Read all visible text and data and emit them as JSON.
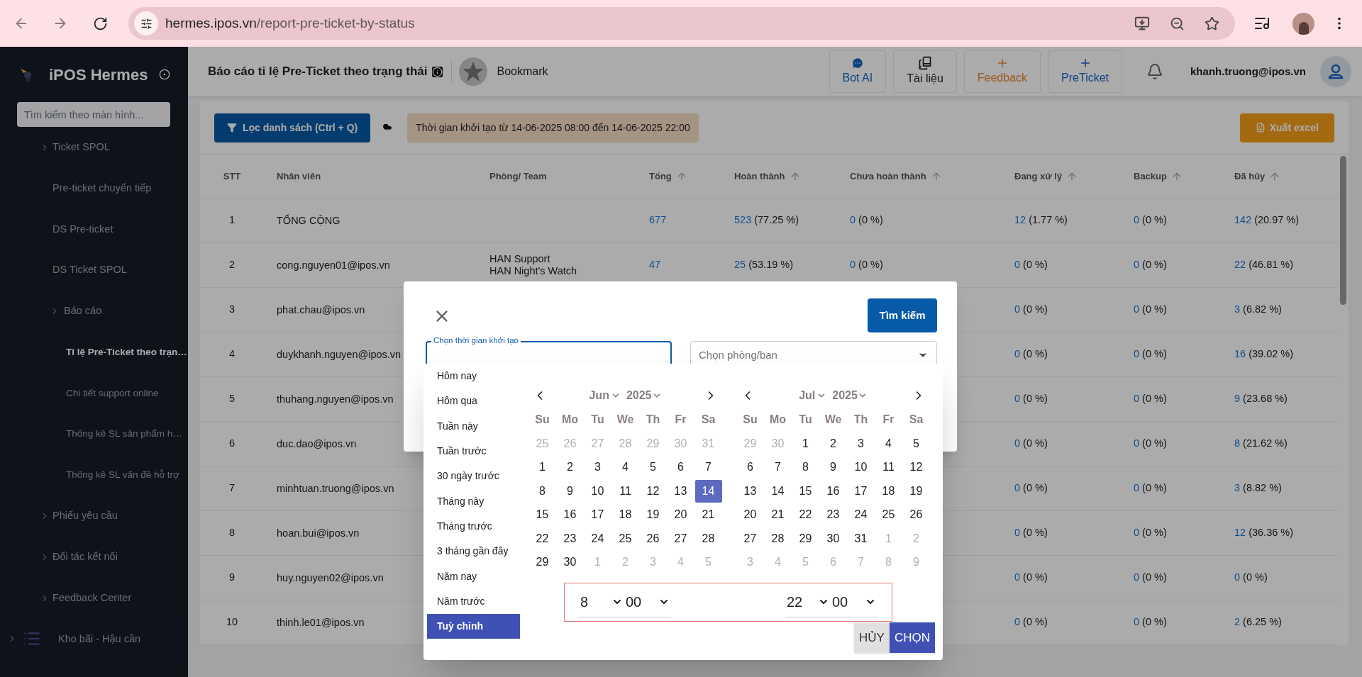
{
  "browser": {
    "url_host": "hermes.ipos.vn",
    "url_path": "/report-pre-ticket-by-status"
  },
  "sidebar": {
    "app_name": "iPOS Hermes",
    "search": {
      "placeholder": "Tìm kiếm theo màn hình..."
    },
    "items": [
      {
        "label": "Ticket SPOL",
        "kind": "group",
        "selected": false
      },
      {
        "label": "Pre-ticket chuyển tiếp",
        "kind": "link",
        "selected": false
      },
      {
        "label": "DS Pre-ticket",
        "kind": "link",
        "selected": false
      },
      {
        "label": "DS Ticket SPOL",
        "kind": "link",
        "selected": false
      },
      {
        "label": "Báo cáo",
        "kind": "subgroup",
        "selected": false,
        "children": [
          {
            "label": "Tỉ lệ Pre-Ticket theo trạn…",
            "kind": "link",
            "selected": true
          },
          {
            "label": "Chi tiết support online",
            "kind": "link",
            "selected": false
          },
          {
            "label": "Thống kê SL sản phẩm h…",
            "kind": "link",
            "selected": false
          },
          {
            "label": "Thống kê SL vấn đề hỗ trợ",
            "kind": "link",
            "selected": false
          }
        ]
      },
      {
        "label": "Phiếu yêu cầu",
        "kind": "group",
        "selected": false
      },
      {
        "label": "Đối tác kết nối",
        "kind": "group",
        "selected": false
      },
      {
        "label": "Feedback Center",
        "kind": "group",
        "selected": false
      },
      {
        "label": "Kho bãi - Hậu cần",
        "kind": "section",
        "selected": false
      }
    ]
  },
  "header": {
    "title": "Báo cáo tỉ lệ Pre-Ticket theo trạng thái",
    "bookmark": "Bookmark",
    "actions": [
      {
        "label": "Bot AI",
        "kind": "chat"
      },
      {
        "label": "Tài liệu",
        "kind": "docs"
      },
      {
        "label": "Feedback",
        "kind": "feedback"
      },
      {
        "label": "PreTicket",
        "kind": "ticket"
      }
    ],
    "user": "khanh.truong@ipos.vn"
  },
  "filter": {
    "button": "Lọc danh sách (Ctrl + Q)",
    "chip": "Thời gian khởi tạo từ 14-06-2025 08:00 đến 14-06-2025 22:00",
    "export": "Xuất excel"
  },
  "table": {
    "columns": [
      {
        "label": "STT",
        "sortable": false
      },
      {
        "label": "Nhân viên",
        "sortable": false
      },
      {
        "label": "Phòng/ Team",
        "sortable": false
      },
      {
        "label": "Tổng",
        "sortable": true
      },
      {
        "label": "Hoàn thành",
        "sortable": true
      },
      {
        "label": "Chưa hoàn thành",
        "sortable": true
      },
      {
        "label": "Đang xử lý",
        "sortable": true
      },
      {
        "label": "Backup",
        "sortable": true
      },
      {
        "label": "Đã hủy",
        "sortable": true
      }
    ],
    "rows": [
      {
        "stt": "1",
        "employee": "TỔNG CỘNG",
        "total": {
          "count": "677"
        },
        "done": {
          "count": "523",
          "percent": "(77.25 %)"
        },
        "not_done": {
          "count": "0",
          "percent": "(0 %)"
        },
        "processing": {
          "count": "12",
          "percent": "(1.77 %)"
        },
        "backup": {
          "count": "0",
          "percent": "(0 %)"
        },
        "cancelled": {
          "count": "142",
          "percent": "(20.97 %)"
        }
      },
      {
        "stt": "2",
        "employee": "cong.nguyen01@ipos.vn",
        "team": [
          "HAN Support",
          "HAN Night's Watch"
        ],
        "total": {
          "count": "47"
        },
        "done": {
          "count": "25",
          "percent": "(53.19 %)"
        },
        "not_done": {
          "count": "0",
          "percent": "(0 %)"
        },
        "processing": {
          "count": "0",
          "percent": "(0 %)"
        },
        "backup": {
          "count": "0",
          "percent": "(0 %)"
        },
        "cancelled": {
          "count": "22",
          "percent": "(46.81 %)"
        }
      },
      {
        "stt": "3",
        "employee": "phat.chau@ipos.vn",
        "processing": {
          "count": "0",
          "percent": "(0 %)"
        },
        "backup": {
          "count": "0",
          "percent": "(0 %)"
        },
        "cancelled": {
          "count": "3",
          "percent": "(6.82 %)"
        }
      },
      {
        "stt": "4",
        "employee": "duykhanh.nguyen@ipos.vn",
        "processing": {
          "count": "0",
          "percent": "(0 %)"
        },
        "backup": {
          "count": "0",
          "percent": "(0 %)"
        },
        "cancelled": {
          "count": "16",
          "percent": "(39.02 %)"
        }
      },
      {
        "stt": "5",
        "employee": "thuhang.nguyen@ipos.vn",
        "processing": {
          "count": "0",
          "percent": "(0 %)"
        },
        "backup": {
          "count": "0",
          "percent": "(0 %)"
        },
        "cancelled": {
          "count": "9",
          "percent": "(23.68 %)"
        }
      },
      {
        "stt": "6",
        "employee": "duc.dao@ipos.vn",
        "processing": {
          "count": "0",
          "percent": "(0 %)"
        },
        "backup": {
          "count": "0",
          "percent": "(0 %)"
        },
        "cancelled": {
          "count": "8",
          "percent": "(21.62 %)"
        }
      },
      {
        "stt": "7",
        "employee": "minhtuan.truong@ipos.vn",
        "processing": {
          "count": "0",
          "percent": "(0 %)"
        },
        "backup": {
          "count": "0",
          "percent": "(0 %)"
        },
        "cancelled": {
          "count": "3",
          "percent": "(8.82 %)"
        }
      },
      {
        "stt": "8",
        "employee": "hoan.bui@ipos.vn",
        "processing": {
          "count": "0",
          "percent": "(0 %)"
        },
        "backup": {
          "count": "0",
          "percent": "(0 %)"
        },
        "cancelled": {
          "count": "12",
          "percent": "(36.36 %)"
        }
      },
      {
        "stt": "9",
        "employee": "huy.nguyen02@ipos.vn",
        "processing": {
          "count": "0",
          "percent": "(0 %)"
        },
        "backup": {
          "count": "0",
          "percent": "(0 %)"
        },
        "cancelled": {
          "count": "0",
          "percent": "(0 %)"
        }
      },
      {
        "stt": "10",
        "employee": "thinh.le01@ipos.vn",
        "processing": {
          "count": "0",
          "percent": "(0 %)"
        },
        "backup": {
          "count": "0",
          "percent": "(0 %)"
        },
        "cancelled": {
          "count": "2",
          "percent": "(6.25 %)"
        }
      }
    ]
  },
  "dialog": {
    "search_button": "Tìm kiếm",
    "date_field": {
      "label": "Chọn thời gian khởi tạo"
    },
    "team_field": {
      "placeholder": "Chọn phòng/ban"
    },
    "date_picker": {
      "presets": [
        {
          "label": "Hôm nay",
          "selected": false
        },
        {
          "label": "Hôm qua",
          "selected": false
        },
        {
          "label": "Tuần này",
          "selected": false
        },
        {
          "label": "Tuần trước",
          "selected": false
        },
        {
          "label": "30 ngày trước",
          "selected": false
        },
        {
          "label": "Tháng này",
          "selected": false
        },
        {
          "label": "Tháng trước",
          "selected": false
        },
        {
          "label": "3 tháng gần đây",
          "selected": false
        },
        {
          "label": "Năm nay",
          "selected": false
        },
        {
          "label": "Năm trước",
          "selected": false
        },
        {
          "label": "Tuỳ chỉnh",
          "selected": true
        }
      ],
      "calendars": [
        {
          "month": "Jun",
          "year": "2025",
          "weekdays": [
            "Su",
            "Mo",
            "Tu",
            "We",
            "Th",
            "Fr",
            "Sa"
          ],
          "days": [
            {
              "d": "25",
              "muted": true,
              "selected": false
            },
            {
              "d": "26",
              "muted": true,
              "selected": false
            },
            {
              "d": "27",
              "muted": true,
              "selected": false
            },
            {
              "d": "28",
              "muted": true,
              "selected": false
            },
            {
              "d": "29",
              "muted": true,
              "selected": false
            },
            {
              "d": "30",
              "muted": true,
              "selected": false
            },
            {
              "d": "31",
              "muted": true,
              "selected": false
            },
            {
              "d": "1",
              "muted": false,
              "selected": false
            },
            {
              "d": "2",
              "muted": false,
              "selected": false
            },
            {
              "d": "3",
              "muted": false,
              "selected": false
            },
            {
              "d": "4",
              "muted": false,
              "selected": false
            },
            {
              "d": "5",
              "muted": false,
              "selected": false
            },
            {
              "d": "6",
              "muted": false,
              "selected": false
            },
            {
              "d": "7",
              "muted": false,
              "selected": false
            },
            {
              "d": "8",
              "muted": false,
              "selected": false
            },
            {
              "d": "9",
              "muted": false,
              "selected": false
            },
            {
              "d": "10",
              "muted": false,
              "selected": false
            },
            {
              "d": "11",
              "muted": false,
              "selected": false
            },
            {
              "d": "12",
              "muted": false,
              "selected": false
            },
            {
              "d": "13",
              "muted": false,
              "selected": false
            },
            {
              "d": "14",
              "muted": false,
              "selected": true
            },
            {
              "d": "15",
              "muted": false,
              "selected": false
            },
            {
              "d": "16",
              "muted": false,
              "selected": false
            },
            {
              "d": "17",
              "muted": false,
              "selected": false
            },
            {
              "d": "18",
              "muted": false,
              "selected": false
            },
            {
              "d": "19",
              "muted": false,
              "selected": false
            },
            {
              "d": "20",
              "muted": false,
              "selected": false
            },
            {
              "d": "21",
              "muted": false,
              "selected": false
            },
            {
              "d": "22",
              "muted": false,
              "selected": false
            },
            {
              "d": "23",
              "muted": false,
              "selected": false
            },
            {
              "d": "24",
              "muted": false,
              "selected": false
            },
            {
              "d": "25",
              "muted": false,
              "selected": false
            },
            {
              "d": "26",
              "muted": false,
              "selected": false
            },
            {
              "d": "27",
              "muted": false,
              "selected": false
            },
            {
              "d": "28",
              "muted": false,
              "selected": false
            },
            {
              "d": "29",
              "muted": false,
              "selected": false
            },
            {
              "d": "30",
              "muted": false,
              "selected": false
            },
            {
              "d": "1",
              "muted": true,
              "selected": false
            },
            {
              "d": "2",
              "muted": true,
              "selected": false
            },
            {
              "d": "3",
              "muted": true,
              "selected": false
            },
            {
              "d": "4",
              "muted": true,
              "selected": false
            },
            {
              "d": "5",
              "muted": true,
              "selected": false
            }
          ]
        },
        {
          "month": "Jul",
          "year": "2025",
          "weekdays": [
            "Su",
            "Mo",
            "Tu",
            "We",
            "Th",
            "Fr",
            "Sa"
          ],
          "days": [
            {
              "d": "29",
              "muted": true,
              "selected": false
            },
            {
              "d": "30",
              "muted": true,
              "selected": false
            },
            {
              "d": "1",
              "muted": false,
              "selected": false
            },
            {
              "d": "2",
              "muted": false,
              "selected": false
            },
            {
              "d": "3",
              "muted": false,
              "selected": false
            },
            {
              "d": "4",
              "muted": false,
              "selected": false
            },
            {
              "d": "5",
              "muted": false,
              "selected": false
            },
            {
              "d": "6",
              "muted": false,
              "selected": false
            },
            {
              "d": "7",
              "muted": false,
              "selected": false
            },
            {
              "d": "8",
              "muted": false,
              "selected": false
            },
            {
              "d": "9",
              "muted": false,
              "selected": false
            },
            {
              "d": "10",
              "muted": false,
              "selected": false
            },
            {
              "d": "11",
              "muted": false,
              "selected": false
            },
            {
              "d": "12",
              "muted": false,
              "selected": false
            },
            {
              "d": "13",
              "muted": false,
              "selected": false
            },
            {
              "d": "14",
              "muted": false,
              "selected": false
            },
            {
              "d": "15",
              "muted": false,
              "selected": false
            },
            {
              "d": "16",
              "muted": false,
              "selected": false
            },
            {
              "d": "17",
              "muted": false,
              "selected": false
            },
            {
              "d": "18",
              "muted": false,
              "selected": false
            },
            {
              "d": "19",
              "muted": false,
              "selected": false
            },
            {
              "d": "20",
              "muted": false,
              "selected": false
            },
            {
              "d": "21",
              "muted": false,
              "selected": false
            },
            {
              "d": "22",
              "muted": false,
              "selected": false
            },
            {
              "d": "23",
              "muted": false,
              "selected": false
            },
            {
              "d": "24",
              "muted": false,
              "selected": false
            },
            {
              "d": "25",
              "muted": false,
              "selected": false
            },
            {
              "d": "26",
              "muted": false,
              "selected": false
            },
            {
              "d": "27",
              "muted": false,
              "selected": false
            },
            {
              "d": "28",
              "muted": false,
              "selected": false
            },
            {
              "d": "29",
              "muted": false,
              "selected": false
            },
            {
              "d": "30",
              "muted": false,
              "selected": false
            },
            {
              "d": "31",
              "muted": false,
              "selected": false
            },
            {
              "d": "1",
              "muted": true,
              "selected": false
            },
            {
              "d": "2",
              "muted": true,
              "selected": false
            },
            {
              "d": "3",
              "muted": true,
              "selected": false
            },
            {
              "d": "4",
              "muted": true,
              "selected": false
            },
            {
              "d": "5",
              "muted": true,
              "selected": false
            },
            {
              "d": "6",
              "muted": true,
              "selected": false
            },
            {
              "d": "7",
              "muted": true,
              "selected": false
            },
            {
              "d": "8",
              "muted": true,
              "selected": false
            },
            {
              "d": "9",
              "muted": true,
              "selected": false
            }
          ]
        }
      ],
      "times": [
        {
          "hour": "8",
          "minute": "00"
        },
        {
          "hour": "22",
          "minute": "00"
        }
      ],
      "cancel": "HỦY",
      "apply": "CHỌN"
    }
  }
}
